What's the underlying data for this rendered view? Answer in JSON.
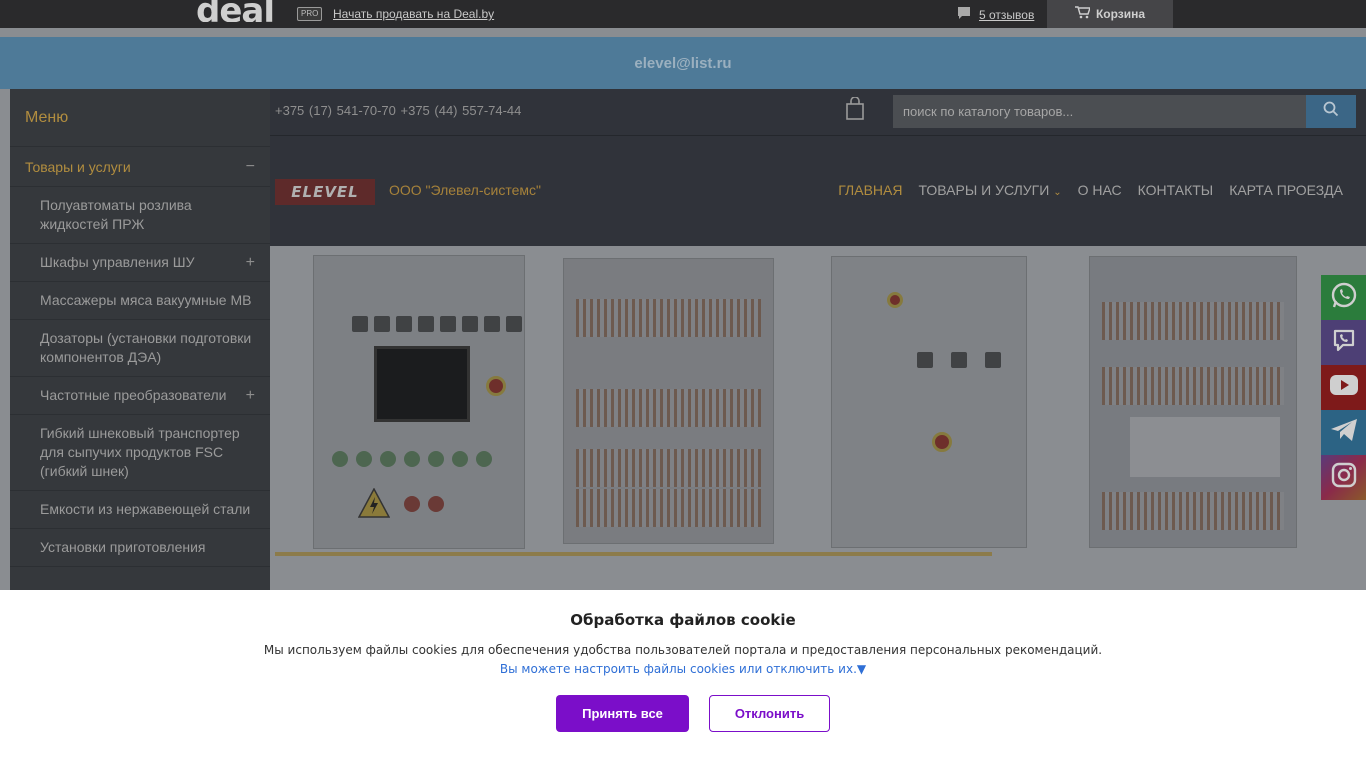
{
  "dealbar": {
    "logo": "deal",
    "pro_badge": "PRO",
    "sell_link": "Начать продавать на Deal.by",
    "reviews": "5 отзывов",
    "cart": "Корзина"
  },
  "email": "elevel@list.ru",
  "sidebar": {
    "title": "Меню",
    "category": "Товары и услуги",
    "category_sign": "−",
    "items": [
      {
        "label": "Полуавтоматы розлива жидкостей ПРЖ",
        "sign": ""
      },
      {
        "label": "Шкафы управления ШУ",
        "sign": "+"
      },
      {
        "label": "Массажеры мяса вакуумные МВ",
        "sign": ""
      },
      {
        "label": "Дозаторы (установки подготовки компонентов ДЭА)",
        "sign": ""
      },
      {
        "label": "Частотные преобразователи",
        "sign": "+"
      },
      {
        "label": "Гибкий шнековый транспортер для сыпучих продуктов FSC (гибкий шнек)",
        "sign": ""
      },
      {
        "label": "Емкости из нержавеющей стали",
        "sign": ""
      },
      {
        "label": "Установки приготовления",
        "sign": ""
      }
    ]
  },
  "header": {
    "phones": "+375 (17) 541-70-70   +375 (44) 557-74-44",
    "search_placeholder": "поиск по каталогу товаров...",
    "logo_text": "ELEVEL",
    "company": "ООО \"Элевел-системс\"",
    "nav": [
      "ГЛАВНАЯ",
      "ТОВАРЫ И УСЛУГИ",
      "О НАС",
      "КОНТАКТЫ",
      "КАРТА ПРОЕЗДА"
    ]
  },
  "banner": {
    "slide_progress": 0.66
  },
  "social": [
    "whatsapp-icon",
    "viber-icon",
    "youtube-icon",
    "telegram-icon",
    "instagram-icon"
  ],
  "cookie": {
    "title": "Обработка файлов cookie",
    "text": "Мы используем файлы cookies для обеспечения удобства пользователей портала и предоставления персональных рекомендаций.",
    "link": "Вы можете настроить файлы cookies или отключить их.▼",
    "accept": "Принять все",
    "decline": "Отклонить"
  },
  "colors": {
    "accent_gold": "#b18d3f",
    "accept_purple": "#7b0ec9",
    "link_blue": "#2f6fd6"
  }
}
